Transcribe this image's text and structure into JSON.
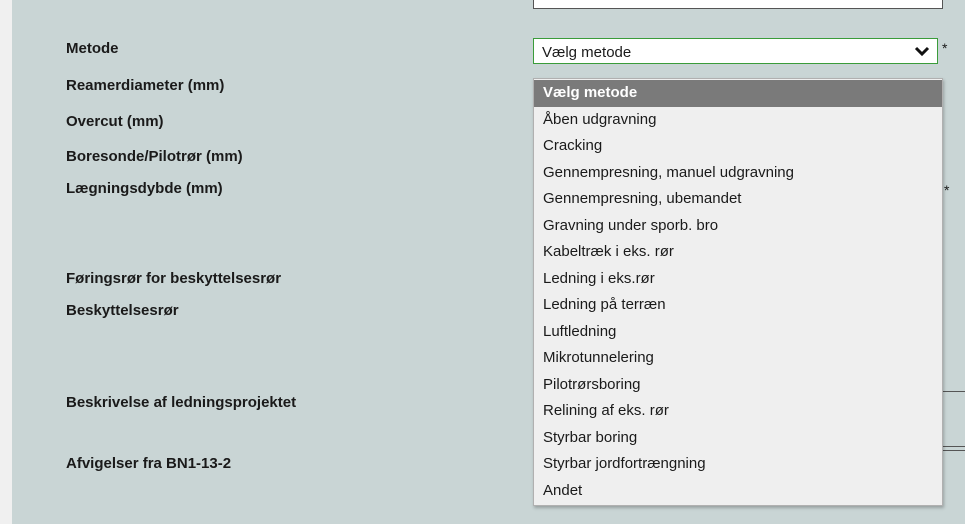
{
  "form": {
    "labels": [
      "Metode",
      "Reamerdiameter (mm)",
      "Overcut (mm)",
      "Boresonde/Pilotrør (mm)",
      "Lægningsdybde (mm)",
      "Føringsrør for beskyttelsesrør",
      "Beskyttelsesrør",
      "Beskrivelse af ledningsprojektet",
      "Afvigelser fra BN1-13-2"
    ],
    "required_mark": "*"
  },
  "metode_select": {
    "value": "Vælg metode",
    "icon": "chevron-down-icon",
    "border_color": "#3a9c3a",
    "options": [
      "Vælg metode",
      "Åben udgravning",
      "Cracking",
      "Gennempresning, manuel udgravning",
      "Gennempresning, ubemandet",
      "Gravning under sporb. bro",
      "Kabeltræk i eks. rør",
      "Ledning i eks.rør",
      "Ledning på terræn",
      "Luftledning",
      "Mikrotunnelering",
      "Pilotrørsboring",
      "Relining af eks. rør",
      "Styrbar boring",
      "Styrbar jordfortrængning",
      "Andet"
    ],
    "selected_index": 0
  },
  "colors": {
    "panel_background": "#c9d5d5",
    "selected_option_background": "#7a7a7a"
  }
}
